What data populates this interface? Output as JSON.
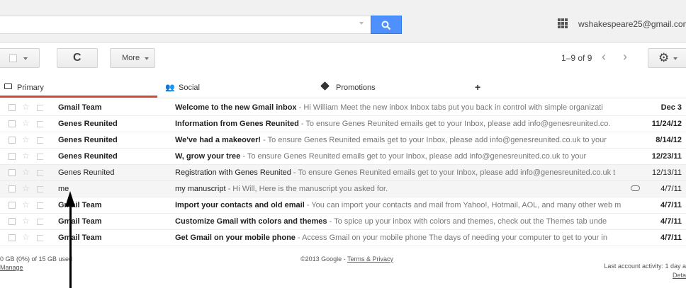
{
  "header": {
    "account_email": "wshakespeare25@gmail.com"
  },
  "toolbar": {
    "more_label": "More",
    "page_info": "1–9 of 9",
    "prev_symbol": "‹",
    "next_symbol": "›"
  },
  "tabs": [
    {
      "label": "Primary",
      "icon": "inbox-icon",
      "active": true
    },
    {
      "label": "Social",
      "icon": "people-icon",
      "active": false
    },
    {
      "label": "Promotions",
      "icon": "tag-icon",
      "active": false
    },
    {
      "label": "+",
      "icon": "add-tab",
      "active": false
    }
  ],
  "emails": [
    {
      "sender": "Gmail Team",
      "subject": "Welcome to the new Gmail inbox",
      "snippet": " - Hi William Meet the new inbox Inbox tabs put you back in control with simple organizati",
      "date": "Dec 3",
      "unread": true,
      "attachment": false
    },
    {
      "sender": "Genes Reunited",
      "subject": "Information from Genes Reunited",
      "snippet": " - To ensure Genes Reunited emails get to your Inbox, please add info@genesreunited.co.",
      "date": "11/24/12",
      "unread": true,
      "attachment": false
    },
    {
      "sender": "Genes Reunited",
      "subject": "We've had a makeover!",
      "snippet": " - To ensure Genes Reunited emails get to your Inbox, please add info@genesreunited.co.uk to your",
      "date": "8/14/12",
      "unread": true,
      "attachment": false
    },
    {
      "sender": "Genes Reunited",
      "subject": "W, grow your tree",
      "snippet": " - To ensure Genes Reunited emails get to your Inbox, please add info@genesreunited.co.uk to your",
      "date": "12/23/11",
      "unread": true,
      "attachment": false
    },
    {
      "sender": "Genes Reunited",
      "subject": "Registration with Genes Reunited",
      "snippet": " - To ensure Genes Reunited emails get to your Inbox, please add info@genesreunited.co.uk t",
      "date": "12/13/11",
      "unread": false,
      "attachment": false
    },
    {
      "sender": "me",
      "subject": "my manuscript",
      "snippet": " - Hi Will, Here is the manuscript you asked for.",
      "date": "4/7/11",
      "unread": false,
      "attachment": true
    },
    {
      "sender": "Gmail Team",
      "subject": "Import your contacts and old email",
      "snippet": " - You can import your contacts and mail from Yahoo!, Hotmail, AOL, and many other web m",
      "date": "4/7/11",
      "unread": true,
      "attachment": false
    },
    {
      "sender": "Gmail Team",
      "subject": "Customize Gmail with colors and themes",
      "snippet": " - To spice up your inbox with colors and themes, check out the Themes tab unde",
      "date": "4/7/11",
      "unread": true,
      "attachment": false
    },
    {
      "sender": "Gmail Team",
      "subject": "Get Gmail on your mobile phone",
      "snippet": " - Access Gmail on your mobile phone The days of needing your computer to get to your in",
      "date": "4/7/11",
      "unread": true,
      "attachment": false
    }
  ],
  "footer": {
    "storage": "0 GB (0%) of 15 GB used",
    "manage": "Manage",
    "copyright": "©2013 Google - ",
    "terms": "Terms & Privacy",
    "last_activity": "Last account activity: 1 day a",
    "details": "Deta"
  },
  "colors": {
    "search_button": "#4d90fe",
    "active_tab_underline": "#d14836"
  }
}
